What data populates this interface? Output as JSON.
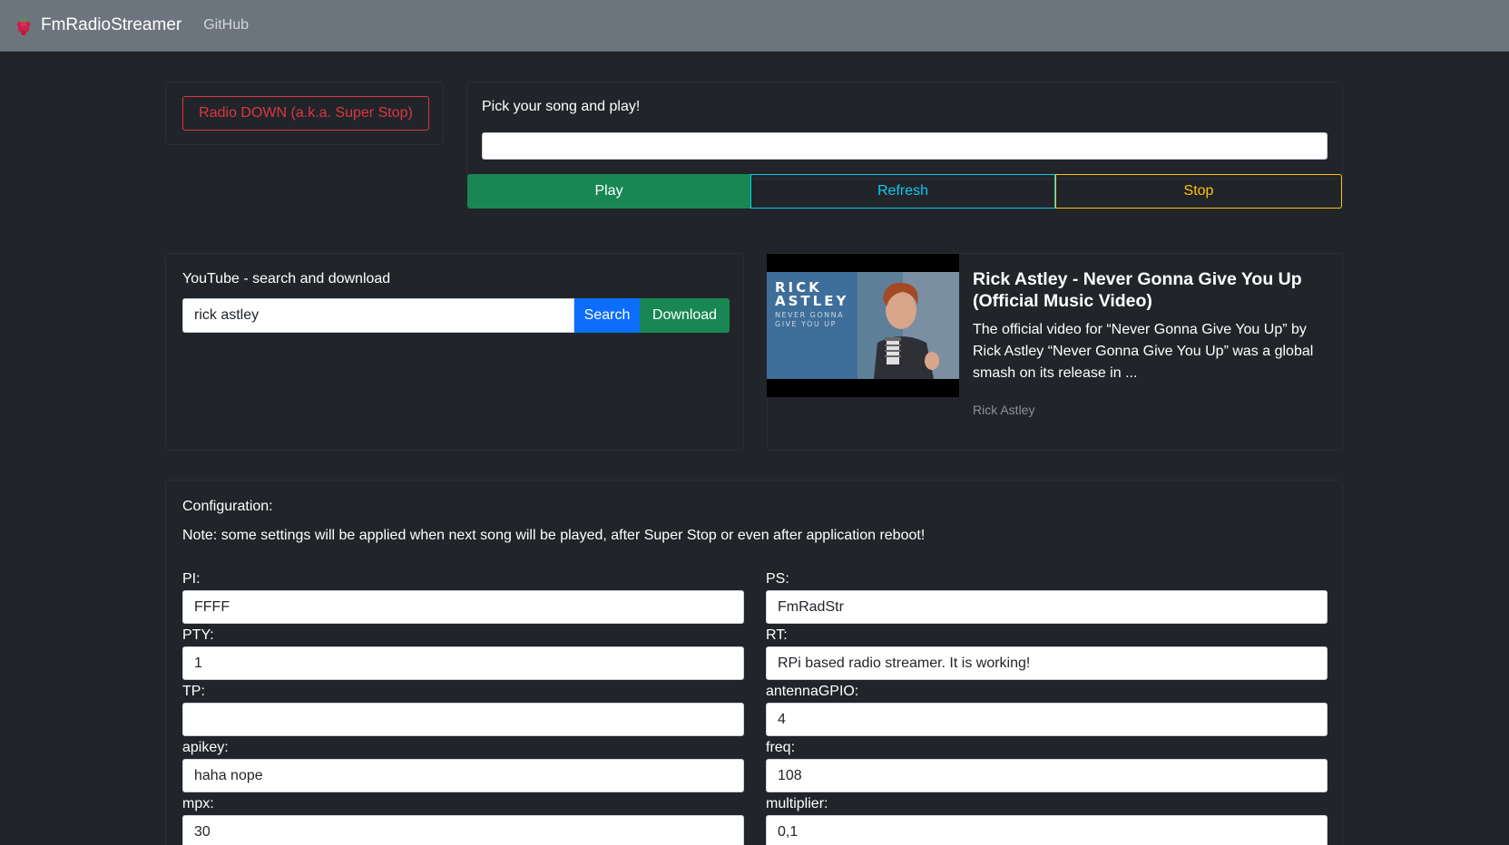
{
  "navbar": {
    "brand": "FmRadioStreamer",
    "github": "GitHub",
    "brand_icon": "raspberry-icon"
  },
  "control": {
    "super_stop_label": "Radio DOWN (a.k.a. Super Stop)",
    "pick_song_label": "Pick your song and play!",
    "song_value": "",
    "play_label": "Play",
    "refresh_label": "Refresh",
    "stop_label": "Stop"
  },
  "youtube": {
    "heading": "YouTube - search and download",
    "search_value": "rick astley",
    "search_label": "Search",
    "download_label": "Download"
  },
  "video": {
    "thumb_title_line1": "RICK",
    "thumb_title_line2": "ASTLEY",
    "thumb_sub_line1": "NEVER GONNA",
    "thumb_sub_line2": "GIVE YOU UP",
    "title": "Rick Astley - Never Gonna Give You Up (Official Music Video)",
    "description": "The official video for “Never Gonna Give You Up” by Rick Astley “Never Gonna Give You Up” was a global smash on its release in ...",
    "channel": "Rick Astley"
  },
  "config": {
    "heading": "Configuration:",
    "note": "Note: some settings will be applied when next song will be played, after Super Stop or even after application reboot!",
    "left": [
      {
        "label": "PI:",
        "value": "FFFF"
      },
      {
        "label": "PTY:",
        "value": "1"
      },
      {
        "label": "TP:",
        "value": ""
      },
      {
        "label": "apikey:",
        "value": "haha nope"
      },
      {
        "label": "mpx:",
        "value": "30"
      }
    ],
    "right": [
      {
        "label": "PS:",
        "value": "FmRadStr"
      },
      {
        "label": "RT:",
        "value": "RPi based radio streamer. It is working!"
      },
      {
        "label": "antennaGPIO:",
        "value": "4"
      },
      {
        "label": "freq:",
        "value": "108"
      },
      {
        "label": "multiplier:",
        "value": "0,1"
      }
    ]
  },
  "colors": {
    "background": "#212529",
    "navbar": "#6c757d",
    "danger": "#dc3545",
    "success": "#198754",
    "info": "#0dcaf0",
    "warning": "#ffc107",
    "primary": "#0d6efd"
  }
}
